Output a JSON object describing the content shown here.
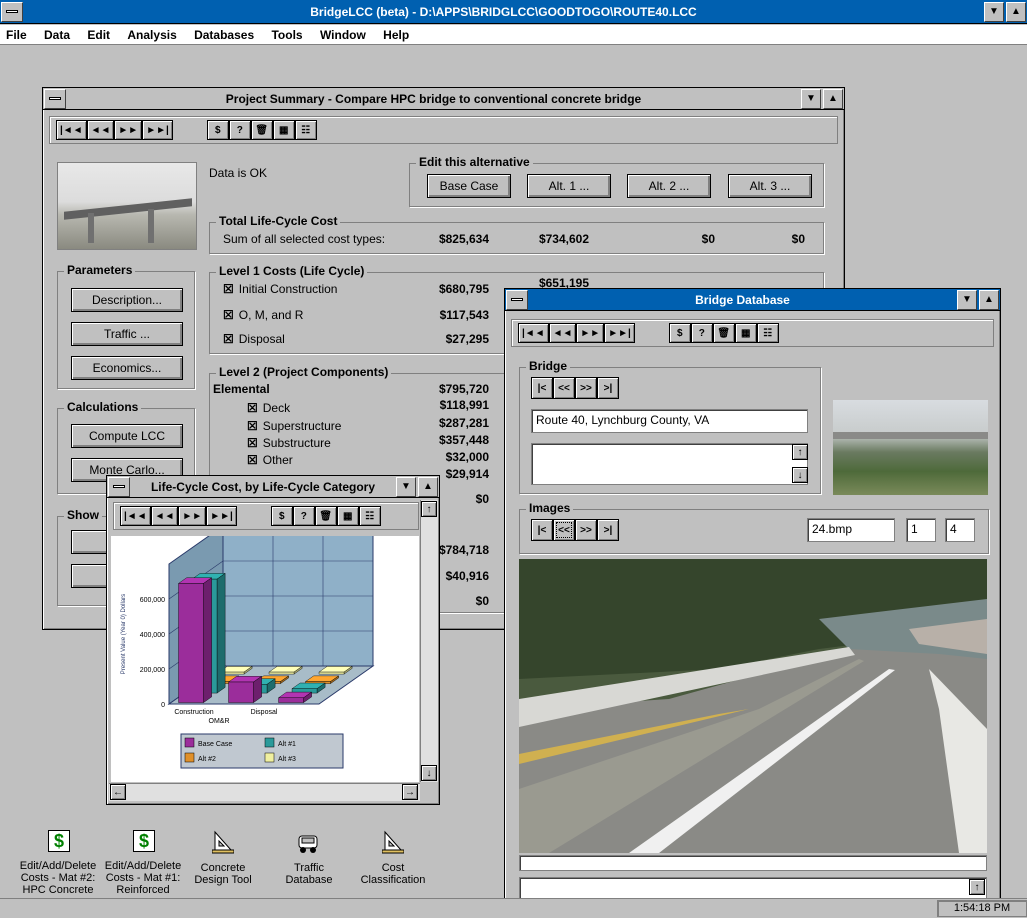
{
  "app": {
    "title": "BridgeLCC (beta) - D:\\APPS\\BRIDGLCC\\GOODTOGO\\ROUTE40.LCC",
    "menu": [
      "File",
      "Data",
      "Edit",
      "Analysis",
      "Databases",
      "Tools",
      "Window",
      "Help"
    ],
    "clock": "1:54:18 PM"
  },
  "nav_buttons": [
    "|◄◄",
    "◄◄",
    "►►",
    "►►|"
  ],
  "tool_buttons": [
    "$",
    "?",
    "🗑",
    "▦",
    "☷"
  ],
  "summary": {
    "title": "Project Summary - Compare HPC bridge to conventional concrete bridge",
    "status": "Data is OK",
    "edit_group": "Edit this alternative",
    "alt_buttons": [
      "Base Case",
      "Alt. 1 ...",
      "Alt. 2 ...",
      "Alt. 3 ..."
    ],
    "total_group": "Total Life-Cycle Cost",
    "total_label": "Sum of all selected cost types:",
    "total_values": [
      "$825,634",
      "$734,602",
      "$0",
      "$0"
    ],
    "params_group": "Parameters",
    "params_buttons": [
      "Description...",
      "Traffic ...",
      "Economics..."
    ],
    "calc_group": "Calculations",
    "calc_buttons": [
      "Compute LCC",
      "Monte Carlo..."
    ],
    "show_group": "Show",
    "level1_group": "Level 1 Costs (Life Cycle)",
    "level1": [
      {
        "label": "Initial Construction",
        "value": "$680,795",
        "value2": "$651,195"
      },
      {
        "label": "O, M, and R",
        "value": "$117,543"
      },
      {
        "label": "Disposal",
        "value": "$27,295"
      }
    ],
    "level2_group": "Level 2 (Project Components)",
    "elemental": {
      "label": "Elemental",
      "value": "$795,720"
    },
    "level2": [
      {
        "label": "Deck",
        "value": "$118,991"
      },
      {
        "label": "Superstructure",
        "value": "$287,281"
      },
      {
        "label": "Substructure",
        "value": "$357,448"
      },
      {
        "label": "Other",
        "value": "$32,000"
      }
    ],
    "extra_values": [
      "$29,914",
      "$0",
      "$784,718",
      "$40,916",
      "$0"
    ]
  },
  "chart_window": {
    "title": "Life-Cycle Cost, by Life-Cycle Category",
    "chart_data": {
      "type": "bar",
      "ylabel": "Present Value (Year 0) Dollars",
      "categories": [
        "Construction",
        "OM&R",
        "Disposal"
      ],
      "yticks": [
        "0",
        "200,000",
        "400,000",
        "600,000"
      ],
      "ylim": [
        0,
        800000
      ],
      "series": [
        {
          "name": "Base Case",
          "color": "#9b2d9b",
          "values": [
            680795,
            117543,
            27295
          ]
        },
        {
          "name": "Alt #1",
          "color": "#2a9a9a",
          "values": [
            651195,
            50000,
            25000
          ]
        },
        {
          "name": "Alt #2",
          "color": "#e0902a",
          "values": [
            0,
            0,
            0
          ]
        },
        {
          "name": "Alt #3",
          "color": "#f0f0a0",
          "values": [
            0,
            0,
            0
          ]
        }
      ]
    }
  },
  "bridge_db": {
    "title": "Bridge Database",
    "bridge_group": "Bridge",
    "bridge_name": "Route 40, Lynchburg County, VA",
    "images_group": "Images",
    "image_file": "24.bmp",
    "image_index": "1",
    "image_count": "4",
    "record_nav": [
      "|<",
      "<<",
      ">>",
      ">|"
    ]
  },
  "desktop_icons": [
    {
      "label": "Edit/Add/Delete Costs - Mat #2: HPC Concrete",
      "icon": "dollar-icon"
    },
    {
      "label": "Edit/Add/Delete Costs - Mat #1: Reinforced",
      "icon": "dollar-icon"
    },
    {
      "label": "Concrete Design Tool",
      "icon": "triangle-ruler-icon"
    },
    {
      "label": "Traffic Database",
      "icon": "car-icon"
    },
    {
      "label": "Cost Classification",
      "icon": "triangle-ruler-icon"
    }
  ]
}
